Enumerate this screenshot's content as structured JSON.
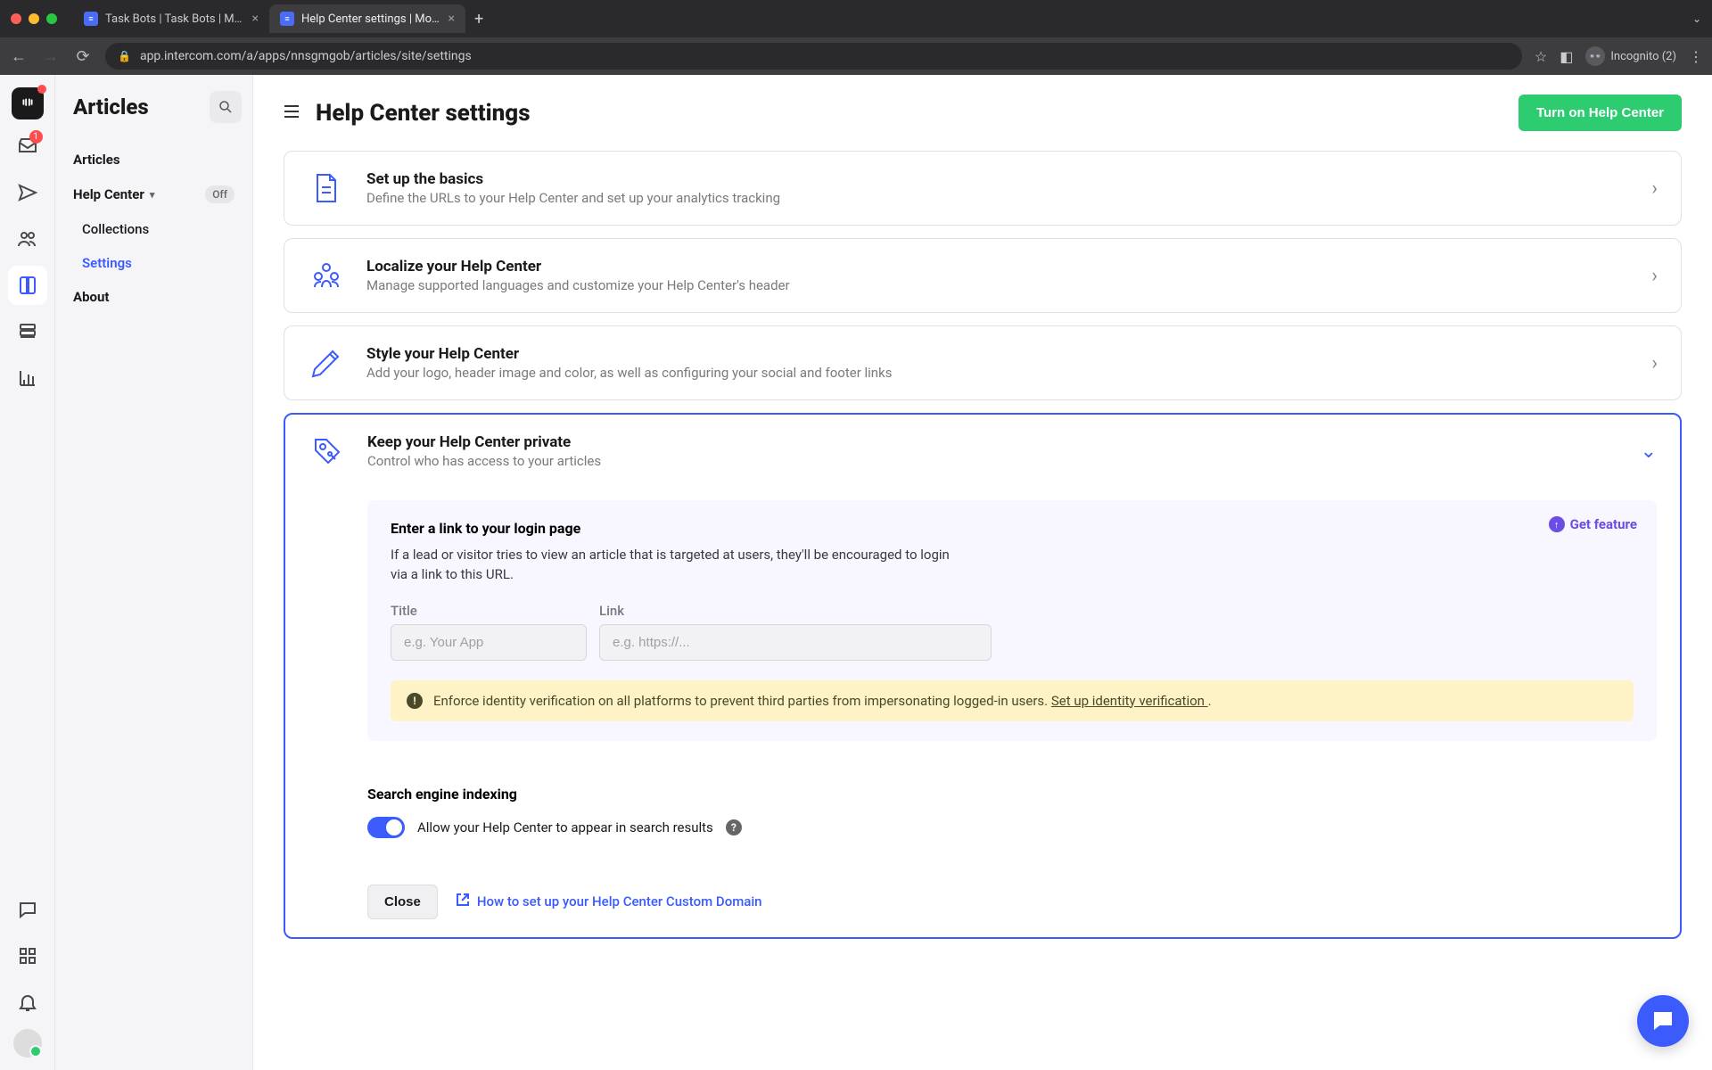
{
  "browser": {
    "tabs": [
      {
        "title": "Task Bots | Task Bots | Moodjo",
        "active": false
      },
      {
        "title": "Help Center settings | Moodjo",
        "active": true
      }
    ],
    "url": "app.intercom.com/a/apps/nnsgmgob/articles/site/settings",
    "incognito_label": "Incognito (2)"
  },
  "iconbar": {
    "inbox_badge": "1"
  },
  "left_panel": {
    "title": "Articles",
    "items": {
      "articles": "Articles",
      "help_center": "Help Center",
      "hc_badge": "Off",
      "collections": "Collections",
      "settings": "Settings",
      "about": "About"
    }
  },
  "header": {
    "title": "Help Center settings",
    "turn_on": "Turn on Help Center"
  },
  "cards": {
    "basics": {
      "title": "Set up the basics",
      "sub": "Define the URLs to your Help Center and set up your analytics tracking"
    },
    "localize": {
      "title": "Localize your Help Center",
      "sub": "Manage supported languages and customize your Help Center's header"
    },
    "style": {
      "title": "Style your Help Center",
      "sub": "Add your logo, header image and color, as well as configuring your social and footer links"
    },
    "private": {
      "title": "Keep your Help Center private",
      "sub": "Control who has access to your articles",
      "get_feature": "Get feature",
      "panel_title": "Enter a link to your login page",
      "panel_desc": "If a lead or visitor tries to view an article that is targeted at users, they'll be encouraged to login via a link to this URL.",
      "title_label": "Title",
      "title_placeholder": "e.g. Your App",
      "link_label": "Link",
      "link_placeholder": "e.g. https://...",
      "alert_text": "Enforce identity verification on all platforms to prevent third parties from impersonating logged-in users. ",
      "alert_link": "Set up identity verification ",
      "alert_tail": ".",
      "sei_title": "Search engine indexing",
      "toggle_label": "Allow your Help Center to appear in search results",
      "close": "Close",
      "howto": "How to set up your Help Center Custom Domain"
    }
  }
}
